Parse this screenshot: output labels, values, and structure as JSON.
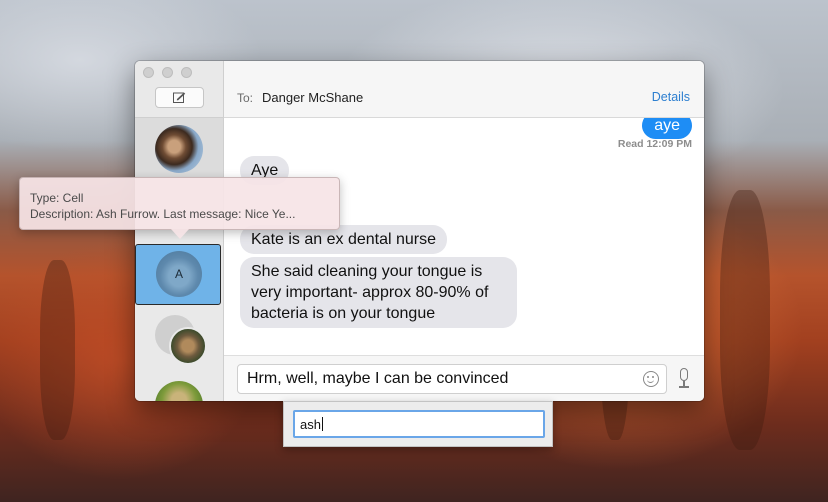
{
  "window": {
    "header": {
      "to_label": "To:",
      "recipient": "Danger McShane",
      "details_label": "Details"
    },
    "sidebar": {
      "compose_icon": "compose-icon",
      "conversations": [
        {
          "avatar": "horse-photo",
          "state": "normal"
        },
        {
          "avatar_initial": "A",
          "state": "selected"
        },
        {
          "avatar": "group-dog-photo",
          "state": "normal"
        },
        {
          "avatar": "green-photo",
          "state": "normal"
        }
      ]
    },
    "messages": [
      {
        "from": "me",
        "text": "aye"
      },
      {
        "status": "Read 12:09 PM"
      },
      {
        "from": "them",
        "text": "Aye"
      },
      {
        "from": "them",
        "text": "Kate is an ex dental nurse"
      },
      {
        "from": "them",
        "text": "She said cleaning your tongue is very important- approx 80-90% of bacteria is on your tongue"
      }
    ],
    "input": {
      "value": "Hrm, well, maybe I can be convinced"
    },
    "icons": {
      "emoji": "emoji-icon",
      "microphone": "microphone-icon"
    }
  },
  "tooltip": {
    "type_line": "Type: Cell",
    "description_line": "Description: Ash Furrow. Last message: Nice Ye..."
  },
  "search_popup": {
    "value": "ash"
  },
  "colors": {
    "accent": "#2d7fd0",
    "my_bubble": "#1e8df5",
    "their_bubble": "#e5e5ea",
    "selected_row": "#6fb3e8"
  }
}
